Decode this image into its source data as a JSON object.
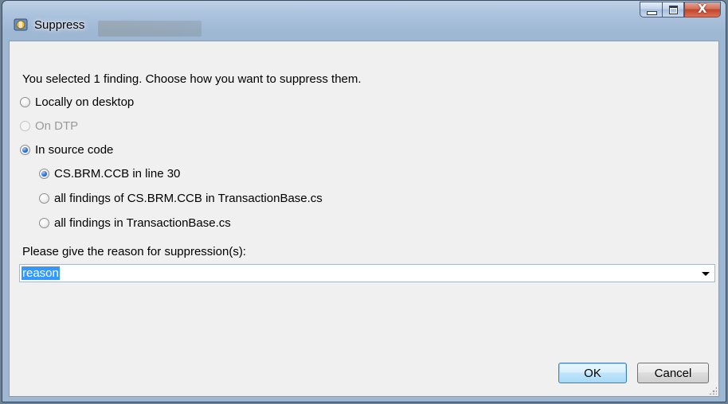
{
  "window": {
    "title": "Suppress",
    "minimize_label": "",
    "maximize_label": "",
    "close_label": "X"
  },
  "dialog": {
    "prompt": "You selected 1 finding. Choose how you want to suppress them.",
    "options": [
      {
        "label": "Locally on desktop",
        "checked": false,
        "enabled": true
      },
      {
        "label": "On DTP",
        "checked": false,
        "enabled": false
      },
      {
        "label": "In source code",
        "checked": true,
        "enabled": true
      }
    ],
    "source_options": [
      {
        "label": "CS.BRM.CCB in line 30",
        "checked": true
      },
      {
        "label": "all findings of CS.BRM.CCB in TransactionBase.cs",
        "checked": false
      },
      {
        "label": "all findings in TransactionBase.cs",
        "checked": false
      }
    ],
    "reason_label": "Please give the reason for suppression(s):",
    "reason_value": "reason"
  },
  "buttons": {
    "ok": "OK",
    "cancel": "Cancel"
  },
  "colors": {
    "selection": "#3399ff",
    "radio_checked": "#2d6ed6",
    "disabled_text": "#9a9a9a"
  }
}
